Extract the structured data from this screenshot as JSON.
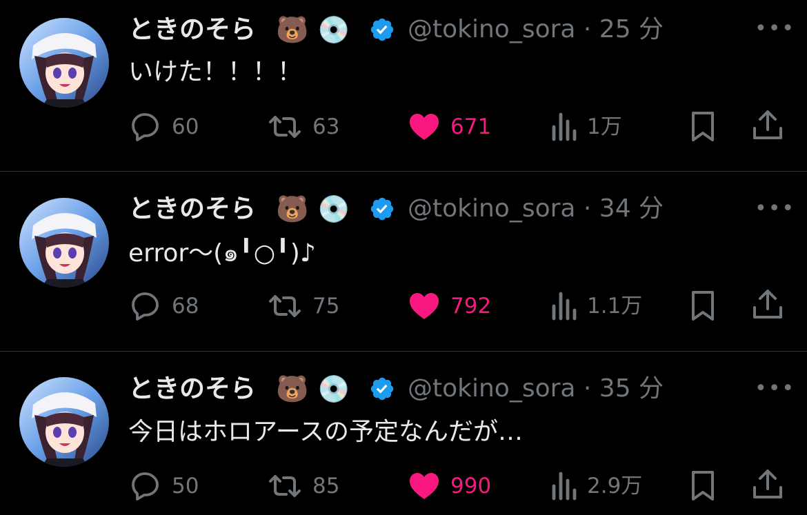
{
  "colors": {
    "background": "#000000",
    "text": "#e7e9ea",
    "muted": "#71767b",
    "like": "#f91880",
    "verified": "#1d9bf0",
    "divider": "#2f3336"
  },
  "tweets": [
    {
      "name": "ときのそら",
      "handle_time": "@tokino_sora · 25 分",
      "text": "いけた！！！！",
      "replies": "60",
      "retweets": "63",
      "likes": "671",
      "views": "1万"
    },
    {
      "name": "ときのそら",
      "handle_time": "@tokino_sora · 34 分",
      "text": "error〜(๑╹○╹)♪",
      "replies": "68",
      "retweets": "75",
      "likes": "792",
      "views": "1.1万"
    },
    {
      "name": "ときのそら",
      "handle_time": "@tokino_sora · 35 分",
      "text": "今日はホロアースの予定なんだが…",
      "replies": "50",
      "retweets": "85",
      "likes": "990",
      "views": "2.9万"
    }
  ],
  "icons": {
    "name_emoji_1": "🐻",
    "name_emoji_2": "💿",
    "verified": "verified-badge-icon",
    "more": "more-icon",
    "reply": "reply-icon",
    "retweet": "retweet-icon",
    "like": "heart-icon",
    "views": "views-icon",
    "bookmark": "bookmark-icon",
    "share": "share-icon"
  }
}
